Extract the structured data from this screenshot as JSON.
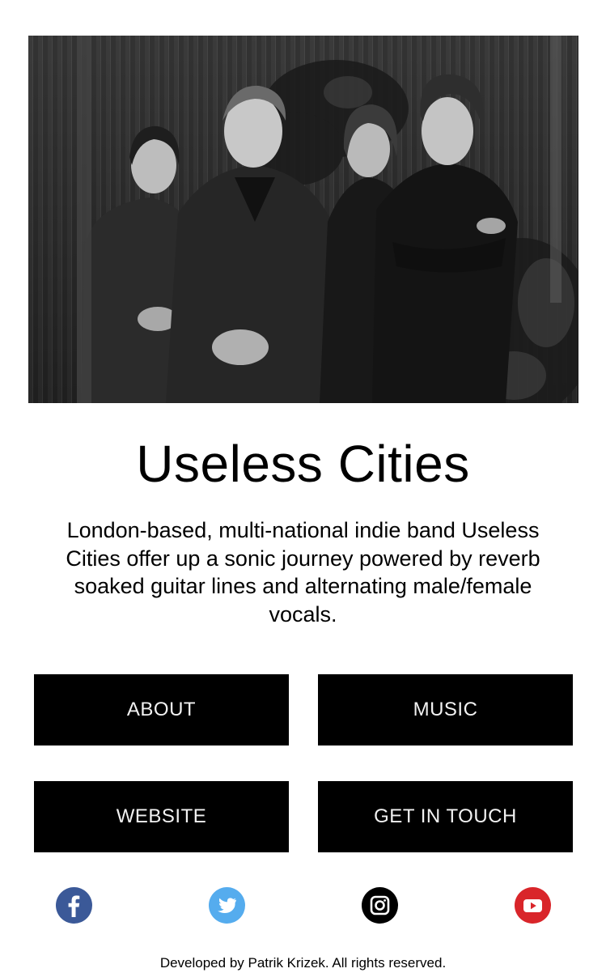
{
  "hero": {
    "image": "band-photo",
    "description": "Black and white photo of four band members standing in front of a corrugated wall with plants"
  },
  "band": {
    "name": "Useless Cities",
    "description": "London-based, multi-national indie band Useless Cities offer up a sonic journey powered by reverb soaked guitar lines and alternating male/female vocals."
  },
  "nav": {
    "about": "ABOUT",
    "music": "MUSIC",
    "website": "WEBSITE",
    "contact": "GET IN TOUCH"
  },
  "social": {
    "facebook": {
      "icon": "facebook-icon",
      "color": "#3b5998"
    },
    "twitter": {
      "icon": "twitter-icon",
      "color": "#55acee"
    },
    "instagram": {
      "icon": "instagram-icon",
      "color": "#000000"
    },
    "youtube": {
      "icon": "youtube-icon",
      "color": "#d9252a"
    }
  },
  "footer": {
    "text": "Developed by Patrik Krizek. All rights reserved."
  }
}
